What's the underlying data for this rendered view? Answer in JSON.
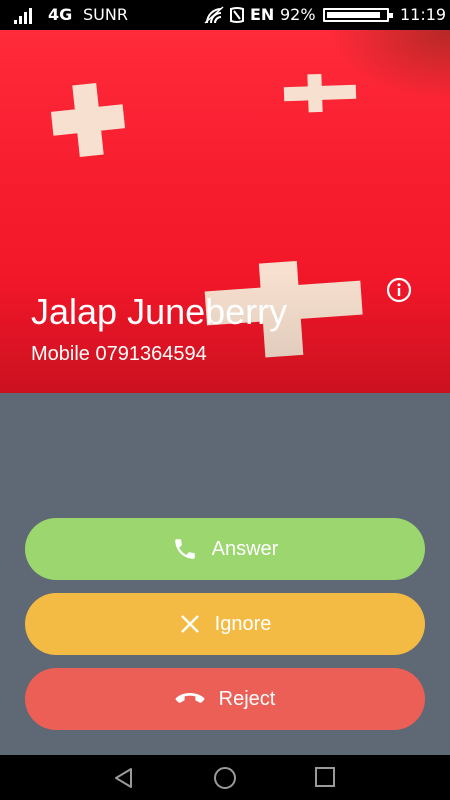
{
  "status_bar": {
    "network": "4G",
    "carrier": "SUNR",
    "language": "EN",
    "battery_percent": "92%",
    "battery_level": 0.92,
    "time": "11:19",
    "icons": [
      "signal-icon",
      "wifi-icon",
      "nfc-icon",
      "battery-icon"
    ]
  },
  "caller": {
    "name": "Jalap Juneberry",
    "number": "Mobile 0791364594",
    "photo": "swiss-flag-fabric"
  },
  "actions": {
    "answer_label": "Answer",
    "ignore_label": "Ignore",
    "reject_label": "Reject"
  },
  "colors": {
    "answer": "#9bd66e",
    "ignore": "#f4bb44",
    "reject": "#ec5f56",
    "background": "#5f6875",
    "photo_red": "#f61c2e"
  },
  "nav": {
    "icons": [
      "back-icon",
      "home-icon",
      "recents-icon"
    ]
  }
}
